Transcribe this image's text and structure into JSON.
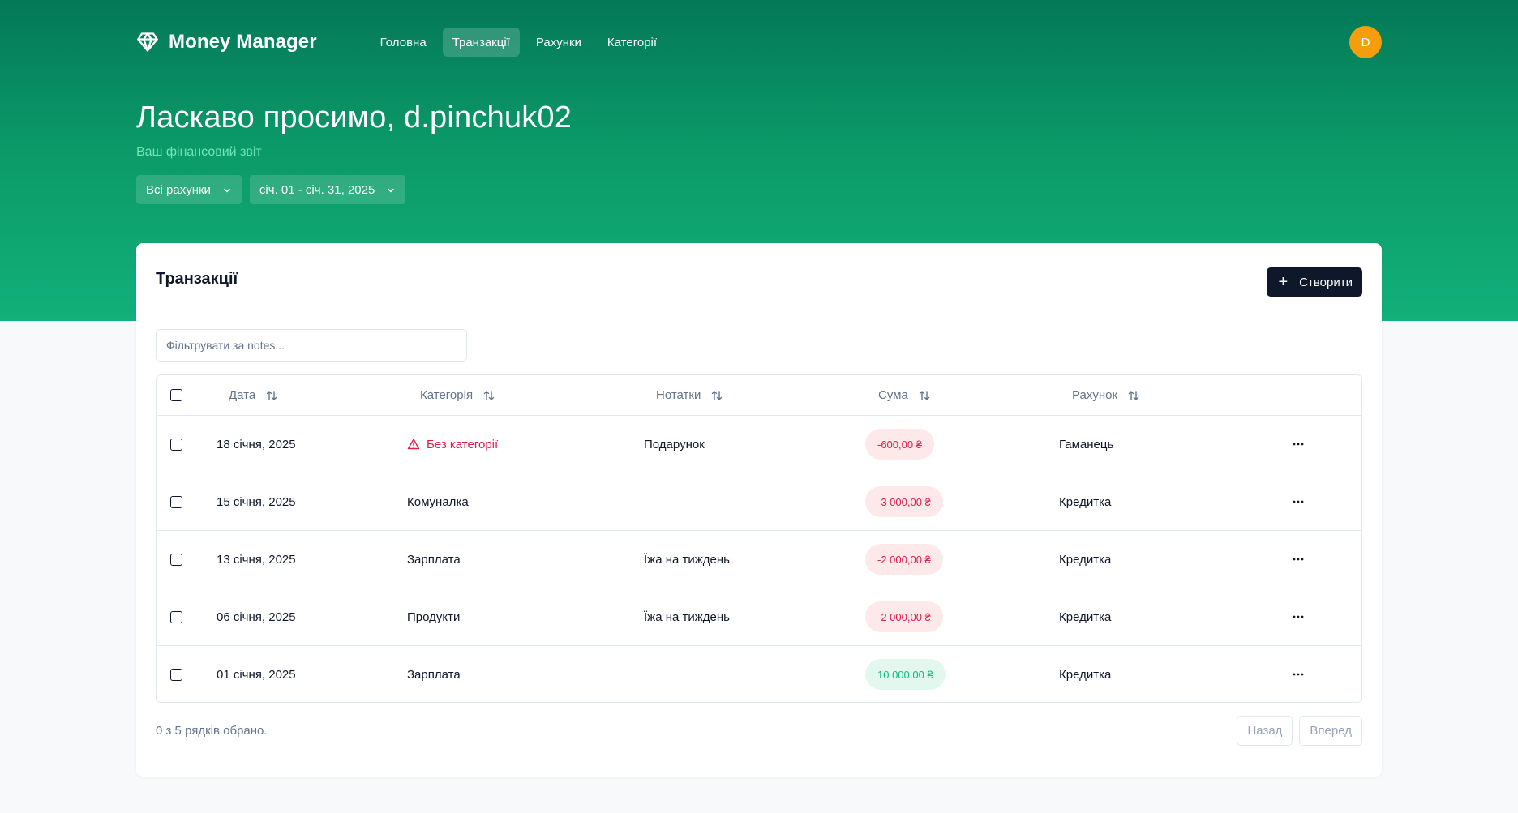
{
  "app": {
    "name": "Money Manager",
    "logo_icon": "diamond-icon"
  },
  "nav": {
    "items": [
      {
        "label": "Головна",
        "active": false
      },
      {
        "label": "Транзакції",
        "active": true
      },
      {
        "label": "Рахунки",
        "active": false
      },
      {
        "label": "Категорії",
        "active": false
      }
    ]
  },
  "user": {
    "initial": "D",
    "avatar_color": "#f59e0b"
  },
  "hero": {
    "welcome": "Ласкаво просимо, d.pinchuk02",
    "subtitle": "Ваш фінансовий звіт",
    "account_filter": "Всі рахунки",
    "date_filter": "січ. 01 - січ. 31, 2025"
  },
  "card": {
    "title": "Транзакції",
    "create_label": "Створити",
    "search_placeholder": "Фільтрувати за notes...",
    "columns": [
      "Дата",
      "Категорія",
      "Нотатки",
      "Сума",
      "Рахунок"
    ],
    "rows": [
      {
        "date": "18 січня, 2025",
        "category": "Без категорії",
        "uncategorized": true,
        "notes": "Подарунок",
        "amount": "-600,00 ₴",
        "kind": "neg",
        "account": "Гаманець"
      },
      {
        "date": "15 січня, 2025",
        "category": "Комуналка",
        "uncategorized": false,
        "notes": "",
        "amount": "-3 000,00 ₴",
        "kind": "neg",
        "account": "Кредитка"
      },
      {
        "date": "13 січня, 2025",
        "category": "Зарплата",
        "uncategorized": false,
        "notes": "Їжа на тиждень",
        "amount": "-2 000,00 ₴",
        "kind": "neg",
        "account": "Кредитка"
      },
      {
        "date": "06 січня, 2025",
        "category": "Продукти",
        "uncategorized": false,
        "notes": "Їжа на тиждень",
        "amount": "-2 000,00 ₴",
        "kind": "neg",
        "account": "Кредитка"
      },
      {
        "date": "01 січня, 2025",
        "category": "Зарплата",
        "uncategorized": false,
        "notes": "",
        "amount": "10 000,00 ₴",
        "kind": "pos",
        "account": "Кредитка"
      }
    ],
    "selection_status": "0 з 5 рядків обрано.",
    "prev_label": "Назад",
    "next_label": "Вперед"
  },
  "colors": {
    "hero_top": "#047857",
    "hero_bottom": "#12b07a",
    "negative": "#e11d48",
    "positive": "#10b981",
    "primary_button": "#0f172a"
  }
}
